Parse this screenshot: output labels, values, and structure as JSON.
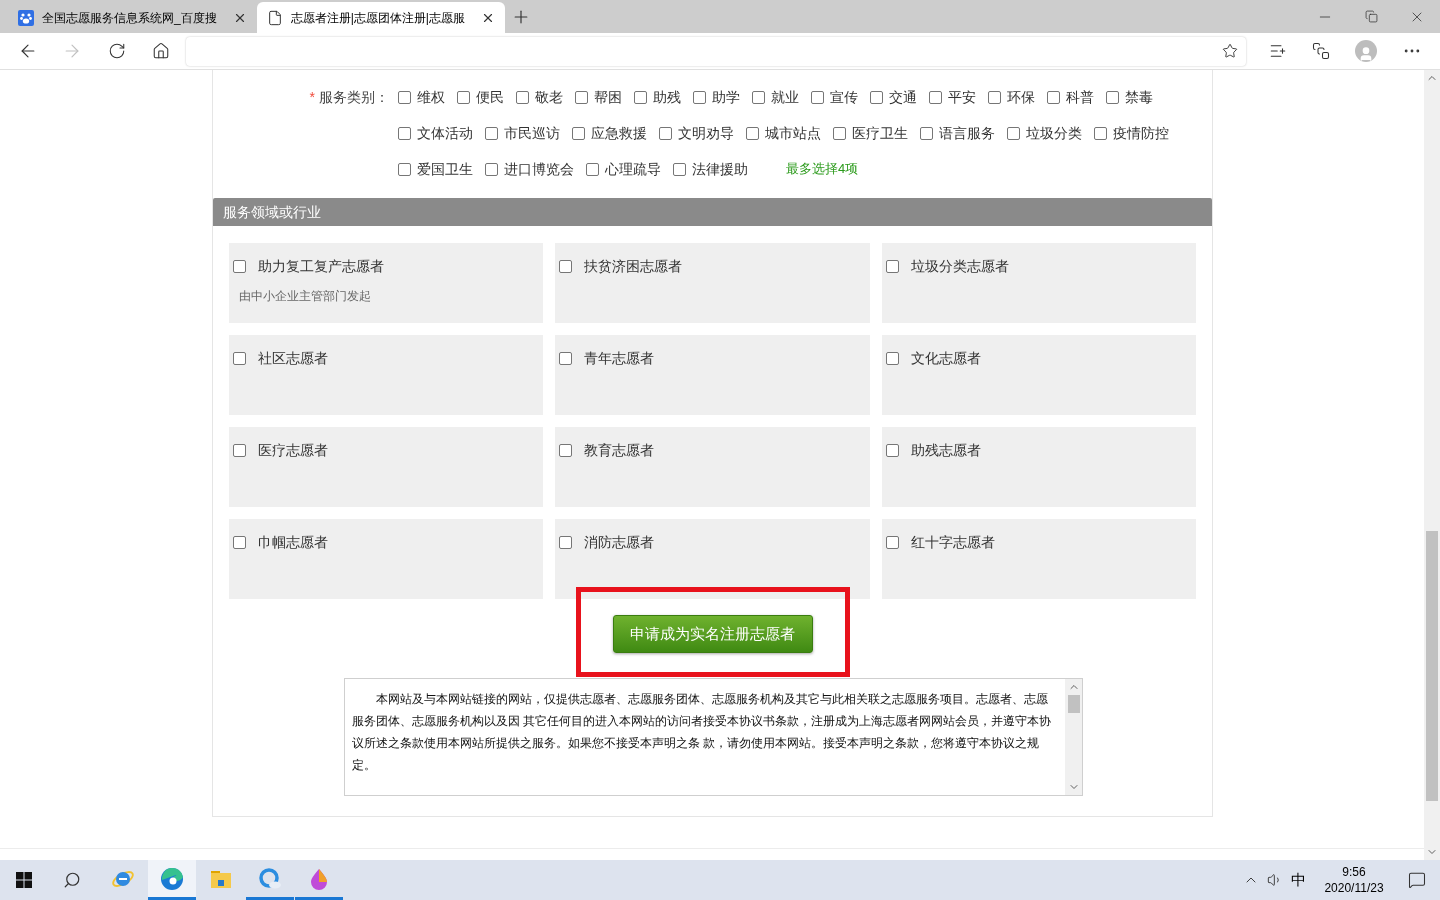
{
  "browser": {
    "tabs": [
      {
        "title": "全国志愿服务信息系统网_百度搜",
        "kind": "paw",
        "selected": false
      },
      {
        "title": "志愿者注册|志愿团体注册|志愿服",
        "kind": "page",
        "selected": true
      }
    ]
  },
  "service_categories": {
    "required_mark": "*",
    "label": "服务类别：",
    "note": "最多选择4项",
    "options": [
      {
        "label": "维权",
        "checked": false
      },
      {
        "label": "便民",
        "checked": false
      },
      {
        "label": "敬老",
        "checked": false
      },
      {
        "label": "帮困",
        "checked": false
      },
      {
        "label": "助残",
        "checked": false
      },
      {
        "label": "助学",
        "checked": false
      },
      {
        "label": "就业",
        "checked": false
      },
      {
        "label": "宣传",
        "checked": false
      },
      {
        "label": "交通",
        "checked": false
      },
      {
        "label": "平安",
        "checked": false
      },
      {
        "label": "环保",
        "checked": false
      },
      {
        "label": "科普",
        "checked": false
      },
      {
        "label": "禁毒",
        "checked": false
      },
      {
        "label": "文体活动",
        "checked": false
      },
      {
        "label": "市民巡访",
        "checked": false
      },
      {
        "label": "应急救援",
        "checked": false
      },
      {
        "label": "文明劝导",
        "checked": false
      },
      {
        "label": "城市站点",
        "checked": false
      },
      {
        "label": "医疗卫生",
        "checked": false
      },
      {
        "label": "语言服务",
        "checked": false
      },
      {
        "label": "垃圾分类",
        "checked": false
      },
      {
        "label": "疫情防控",
        "checked": false
      },
      {
        "label": "爱国卫生",
        "checked": false
      },
      {
        "label": "进口博览会",
        "checked": false
      },
      {
        "label": "心理疏导",
        "checked": false
      },
      {
        "label": "法律援助",
        "checked": false
      }
    ]
  },
  "service_fields": {
    "title": "服务领域或行业",
    "items": [
      {
        "label": "助力复工复产志愿者",
        "note": "由中小企业主管部门发起",
        "checked": false
      },
      {
        "label": "扶贫济困志愿者",
        "checked": false
      },
      {
        "label": "垃圾分类志愿者",
        "checked": false
      },
      {
        "label": "社区志愿者",
        "checked": false
      },
      {
        "label": "青年志愿者",
        "checked": false
      },
      {
        "label": "文化志愿者",
        "checked": false
      },
      {
        "label": "医疗志愿者",
        "checked": false
      },
      {
        "label": "教育志愿者",
        "checked": false
      },
      {
        "label": "助残志愿者",
        "checked": false
      },
      {
        "label": "巾帼志愿者",
        "checked": false
      },
      {
        "label": "消防志愿者",
        "checked": false
      },
      {
        "label": "红十字志愿者",
        "checked": false
      }
    ]
  },
  "submit_button": {
    "label": "申请成为实名注册志愿者",
    "highlighted": true
  },
  "agreement": "本网站及与本网站链接的网站，仅提供志愿者、志愿服务团体、志愿服务机构及其它与此相关联之志愿服务项目。志愿者、志愿服务团体、志愿服务机构以及因 其它任何目的进入本网站的访问者接受本协议书条款，注册成为上海志愿者网网站会员，并遵守本协议所述之条款使用本网站所提供之服务。如果您不接受本声明之条 款，请勿使用本网站。接受本声明之条款，您将遵守本协议之规定。",
  "taskbar": {
    "apps": [
      {
        "kind": "ie",
        "selected": false,
        "open": false
      },
      {
        "kind": "edge",
        "selected": true,
        "open": true
      },
      {
        "kind": "explorer",
        "selected": false,
        "open": false
      },
      {
        "kind": "cloud",
        "selected": false,
        "open": true
      },
      {
        "kind": "paint",
        "selected": false,
        "open": true
      }
    ],
    "ime": "中",
    "time": "9:56",
    "date": "2020/11/23"
  }
}
